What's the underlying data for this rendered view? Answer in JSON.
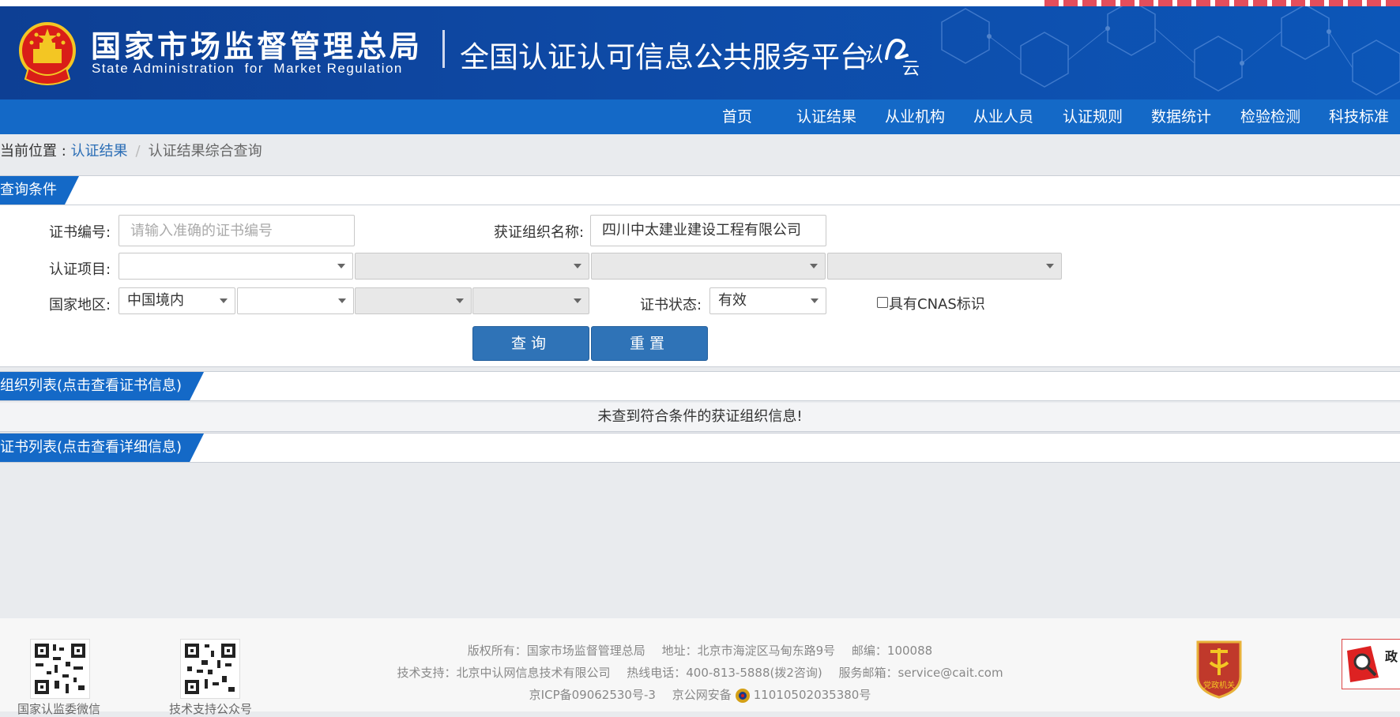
{
  "header": {
    "org_cn": "国家市场监督管理总局",
    "org_en": "State Administration  for  Market Regulation",
    "platform_title": "全国认证认可信息公共服务平台",
    "brand_logo_text": "认云"
  },
  "nav": {
    "items": [
      "首页",
      "认证结果",
      "从业机构",
      "从业人员",
      "认证规则",
      "数据统计",
      "检验检测",
      "科技标准"
    ]
  },
  "breadcrumb": {
    "prefix": "当前位置 : ",
    "link": "认证结果",
    "separator": "/",
    "current": "认证结果综合查询"
  },
  "query": {
    "section_title": "查询条件",
    "cert_no_label": "证书编号:",
    "cert_no_placeholder": "请输入准确的证书编号",
    "cert_no_value": "",
    "org_name_label": "获证组织名称:",
    "org_name_value": "四川中太建业建设工程有限公司",
    "project_label": "认证项目:",
    "region_label": "国家地区:",
    "region_value": "中国境内",
    "status_label": "证书状态:",
    "status_value": "有效",
    "cnas_label": "具有CNAS标识",
    "cnas_checked": false,
    "search_button": "查询",
    "reset_button": "重置"
  },
  "org_list": {
    "section_title": "组织列表(点击查看证书信息)",
    "empty_message": "未查到符合条件的获证组织信息!"
  },
  "cert_list": {
    "section_title": "证书列表(点击查看详细信息)"
  },
  "footer": {
    "qr_wechat_label": "国家认监委微信",
    "qr_tech_label": "技术支持公众号",
    "line1": [
      "版权所有：国家市场监督管理总局",
      "地址：北京市海淀区马甸东路9号",
      "邮编：100088"
    ],
    "line2": [
      "技术支持：北京中认网信息技术有限公司",
      "热线电话：400-813-5888(拨2咨询)",
      "服务邮箱：service@cait.com"
    ],
    "icp": "京ICP备09062530号-3",
    "police_prefix": "京公网安备",
    "police_no": "11010502035380号",
    "party_badge_text": "党政机关",
    "gov_text": "政"
  },
  "colors": {
    "header_blue": "#0e4aa6",
    "nav_blue": "#1469c7",
    "button_blue": "#2f73b7",
    "link_blue": "#2a6db5",
    "page_bg": "#e9ebee"
  }
}
